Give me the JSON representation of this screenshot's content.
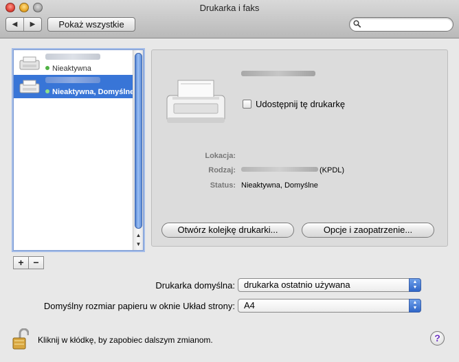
{
  "window": {
    "title": "Drukarka i faks"
  },
  "toolbar": {
    "back_glyph": "◀",
    "forward_glyph": "▶",
    "show_all_label": "Pokaż wszystkie",
    "search_placeholder": "",
    "search_value": ""
  },
  "printer_list": {
    "items": [
      {
        "status": "Nieaktywna",
        "selected": false
      },
      {
        "status": "Nieaktywna, Domyślne",
        "selected": true
      }
    ],
    "add_label": "+",
    "remove_label": "−"
  },
  "details": {
    "share_label": "Udostępnij tę drukarkę",
    "share_checked": false,
    "location_label": "Lokacja:",
    "location_value": "",
    "kind_label": "Rodzaj:",
    "kind_suffix": "(KPDL)",
    "status_label": "Status:",
    "status_value": "Nieaktywna, Domyślne",
    "open_queue_label": "Otwórz kolejkę drukarki...",
    "options_label": "Opcje i zaopatrzenie..."
  },
  "defaults": {
    "default_printer_label": "Drukarka domyślna:",
    "default_printer_value": "drukarka ostatnio używana",
    "paper_size_label": "Domyślny rozmiar papieru w oknie Układ strony:",
    "paper_size_value": "A4"
  },
  "footer": {
    "lock_text": "Kliknij w kłódkę, by zapobiec dalszym zmianom.",
    "help_glyph": "?"
  },
  "colors": {
    "selection": "#3875d7",
    "status_dot": "#4fb243"
  }
}
